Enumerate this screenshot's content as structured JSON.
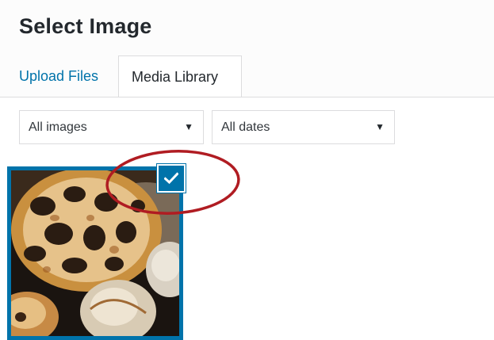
{
  "modal": {
    "title": "Select Image"
  },
  "tabs": [
    {
      "label": "Upload Files",
      "active": false
    },
    {
      "label": "Media Library",
      "active": true
    }
  ],
  "filters": {
    "type": {
      "selected": "All images"
    },
    "date": {
      "selected": "All dates"
    }
  },
  "attachments": [
    {
      "selected": true,
      "icon": "checkmark-icon"
    }
  ],
  "colors": {
    "accent": "#0073aa",
    "link": "#0073aa",
    "annotation_circle": "#b01c22"
  }
}
